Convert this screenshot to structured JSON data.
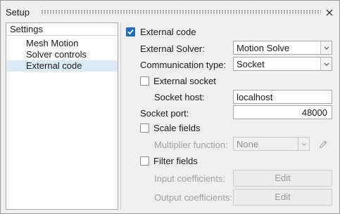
{
  "window": {
    "title": "Setup"
  },
  "tree": {
    "header": "Settings",
    "items": [
      "Mesh Motion",
      "Solver controls",
      "External code"
    ],
    "selected_index": 2
  },
  "form": {
    "external_code": {
      "label": "External code",
      "checked": true
    },
    "external_solver": {
      "label": "External Solver:",
      "value": "Motion Solve"
    },
    "communication_type": {
      "label": "Communication type:",
      "value": "Socket"
    },
    "external_socket": {
      "label": "External socket",
      "checked": false
    },
    "socket_host": {
      "label": "Socket host:",
      "value": "localhost"
    },
    "socket_port": {
      "label": "Socket port:",
      "value": "48000"
    },
    "scale_fields": {
      "label": "Scale fields",
      "checked": false
    },
    "multiplier_function": {
      "label": "Multiplier function:",
      "value": "None"
    },
    "filter_fields": {
      "label": "Filter fields",
      "checked": false
    },
    "input_coefficients": {
      "label": "Input coefficients:",
      "button": "Edit"
    },
    "output_coefficients": {
      "label": "Output coefficients:",
      "button": "Edit"
    }
  },
  "icons": {
    "close": "close-icon",
    "check": "checkmark-icon",
    "dropdown": "chevron-down-icon",
    "pencil": "pencil-icon"
  },
  "colors": {
    "accent": "#1c6fc2",
    "selection": "#ddebf7"
  }
}
